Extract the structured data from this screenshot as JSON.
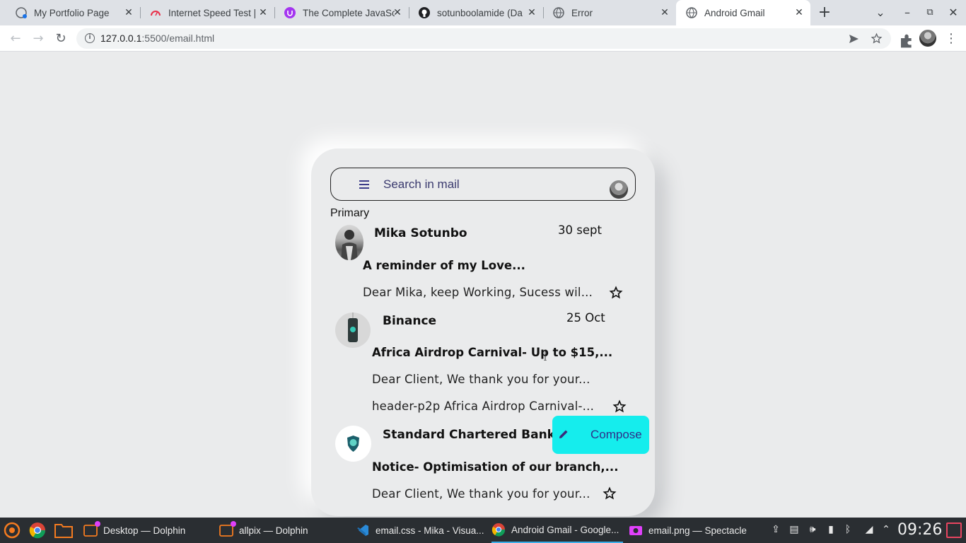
{
  "browser": {
    "tabs": [
      {
        "title": "My Portfolio Page",
        "icon": "globe-icon"
      },
      {
        "title": "Internet Speed Test |",
        "icon": "speedtest-icon"
      },
      {
        "title": "The Complete JavaSc",
        "icon": "udemy-icon"
      },
      {
        "title": "sotunboolamide (Da",
        "icon": "github-icon"
      },
      {
        "title": "Error",
        "icon": "globe-icon"
      },
      {
        "title": "Android Gmail",
        "icon": "globe-icon",
        "active": true
      }
    ],
    "new_tab_label": "+",
    "url_host": "127.0.0.1",
    "url_path": ":5500/email.html"
  },
  "app": {
    "search_placeholder": "Search in mail",
    "section_label": "Primary",
    "emails": [
      {
        "sender": "Mika Sotunbo",
        "date": "30 sept",
        "subject": "A reminder of my Love...",
        "previews": [
          "Dear Mika, keep Working, Sucess wil..."
        ],
        "starred": false
      },
      {
        "sender": "Binance",
        "date": "25 Oct",
        "subject": "Africa Airdrop Carnival- Up to $15,...",
        "previews": [
          "Dear Client, We thank you for your...",
          "header-p2p Africa Airdrop Carnival-..."
        ],
        "starred": false
      },
      {
        "sender": "Standard Chartered Bank",
        "date": "",
        "subject": "Notice- Optimisation of our branch,...",
        "previews": [
          "Dear Client, We thank you for your..."
        ],
        "starred": false
      }
    ],
    "compose_label": "Compose",
    "accent_color": "#15eded"
  },
  "taskbar": {
    "items": [
      {
        "label": "Desktop — Dolphin",
        "icon": "dolphin-icon"
      },
      {
        "label": "allpix — Dolphin",
        "icon": "dolphin-icon"
      },
      {
        "label": "email.css - Mika - Visua...",
        "icon": "vscode-icon"
      },
      {
        "label": "Android Gmail - Google...",
        "icon": "chrome-icon",
        "active": true
      },
      {
        "label": "email.png — Spectacle",
        "icon": "spectacle-icon"
      }
    ],
    "clock": "09:26"
  }
}
